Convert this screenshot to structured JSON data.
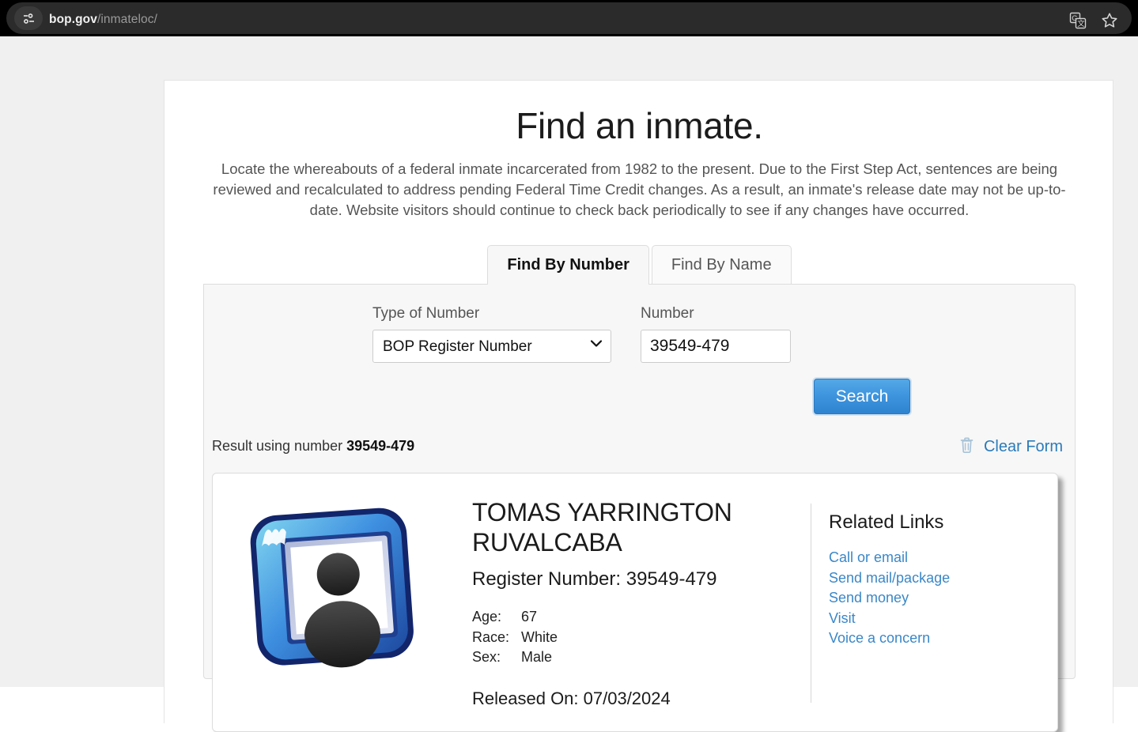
{
  "browser": {
    "url_host": "bop.gov",
    "url_path": "/inmateloc/",
    "site_info_icon": "site-settings-icon",
    "translate_icon": "translate-icon",
    "bookmark_icon": "bookmark-star-icon"
  },
  "page": {
    "title": "Find an inmate.",
    "description": "Locate the whereabouts of a federal inmate incarcerated from 1982 to the present. Due to the First Step Act, sentences are being reviewed and recalculated to address pending Federal Time Credit changes. As a result, an inmate's release date may not be up-to-date. Website visitors should continue to check back periodically to see if any changes have occurred."
  },
  "tabs": [
    {
      "label": "Find By Number",
      "active": true
    },
    {
      "label": "Find By Name",
      "active": false
    }
  ],
  "form": {
    "type_label": "Type of Number",
    "type_value": "BOP Register Number",
    "type_options": [
      "BOP Register Number"
    ],
    "number_label": "Number",
    "number_value": "39549-479",
    "number_placeholder": "",
    "search_label": "Search",
    "search_button_color": "#3d94dd",
    "chevron_icon": "chevron-down-icon"
  },
  "result_summary": {
    "prefix": "Result using number ",
    "number": "39549-479"
  },
  "clear_form": {
    "label": "Clear Form",
    "icon": "trash-icon",
    "color": "#2b7bb9"
  },
  "inmate": {
    "photo_icon": "photo-placeholder-icon",
    "name": "TOMAS YARRINGTON RUVALCABA",
    "register_number_line": "Register Number: 39549-479",
    "attributes": [
      {
        "key": "Age:",
        "value": "67"
      },
      {
        "key": "Race:",
        "value": "White"
      },
      {
        "key": "Sex:",
        "value": "Male"
      }
    ],
    "release_line": "Released On: 07/03/2024"
  },
  "related_links": {
    "title": "Related Links",
    "link_color": "#3a87c8",
    "items": [
      {
        "label": "Call or email"
      },
      {
        "label": "Send mail/package"
      },
      {
        "label": "Send money"
      },
      {
        "label": "Visit"
      },
      {
        "label": "Voice a concern"
      }
    ]
  }
}
